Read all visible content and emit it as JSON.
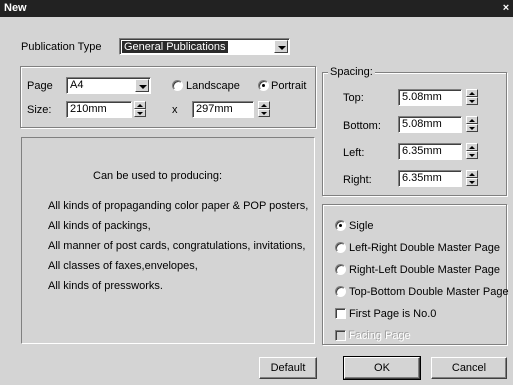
{
  "window": {
    "title": "New",
    "close_glyph": "×"
  },
  "publication": {
    "label": "Publication Type",
    "value": "General Publications"
  },
  "page": {
    "page_label": "Page",
    "page_value": "A4",
    "size_label": "Size:",
    "width": "210mm",
    "x_sep": "x",
    "height": "297mm",
    "orientation": {
      "landscape": "Landscape",
      "portrait": "Portrait",
      "selected": "portrait"
    }
  },
  "spacing": {
    "title": "Spacing:",
    "top_label": "Top:",
    "top": "5.08mm",
    "bottom_label": "Bottom:",
    "bottom": "5.08mm",
    "left_label": "Left:",
    "left": "6.35mm",
    "right_label": "Right:",
    "right": "6.35mm"
  },
  "description": {
    "heading": "Can be used to producing:",
    "lines": [
      "All kinds of propaganding color paper & POP posters,",
      "All kinds of packings,",
      "All manner of post cards, congratulations, invitations,",
      "All classes of faxes,envelopes,",
      "All kinds of pressworks."
    ]
  },
  "layout": {
    "options": [
      "Sigle",
      "Left-Right Double Master Page",
      "Right-Left Double Master Page",
      "Top-Bottom Double Master Page"
    ],
    "selected_index": 0,
    "first_page_label": "First Page is No.0",
    "facing_page_label": "Facing Page"
  },
  "buttons": {
    "default": "Default",
    "ok": "OK",
    "cancel": "Cancel"
  }
}
